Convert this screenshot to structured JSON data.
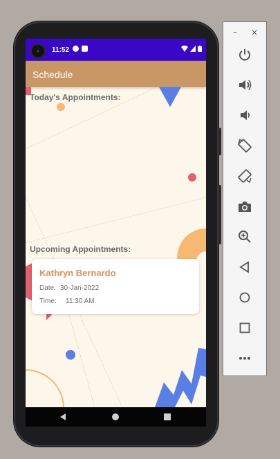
{
  "status_bar": {
    "time": "11:52"
  },
  "app_bar": {
    "title": "Schedule"
  },
  "sections": {
    "today_title": "Today's Appointments:",
    "upcoming_title": "Upcoming Appointments:"
  },
  "appointments": [
    {
      "name": "Kathryn Bernardo",
      "date_label": "Date:",
      "date": "30-Jan-2022",
      "time_label": "Time:",
      "time": "11:30 AM"
    }
  ],
  "colors": {
    "status_bar": "#3b07c6",
    "app_bar": "#c99665",
    "screen_bg": "#fdf6ea",
    "accent_name": "#d4915e"
  },
  "toolbar": {
    "minimize": "–",
    "close": "×",
    "buttons": [
      "power-icon",
      "volume-up-icon",
      "volume-down-icon",
      "rotate-left-icon",
      "rotate-right-icon",
      "camera-icon",
      "zoom-icon",
      "back-icon",
      "home-icon",
      "overview-icon",
      "more-icon"
    ]
  }
}
